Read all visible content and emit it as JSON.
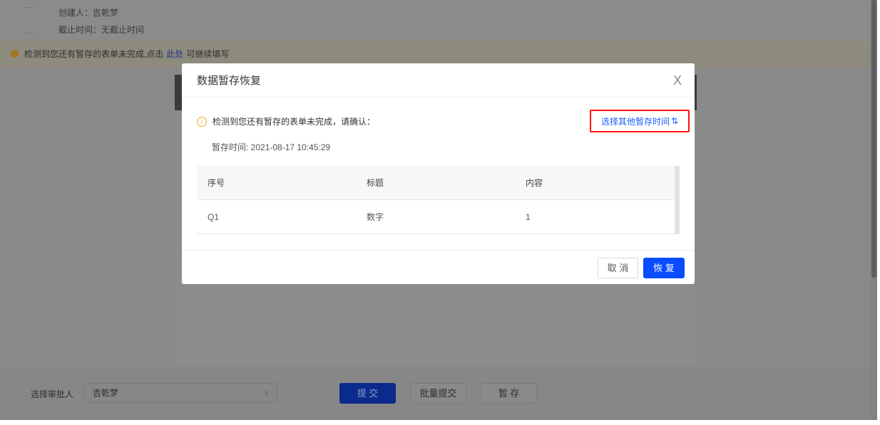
{
  "header": {
    "creator_label": "创建人：吉乾梦",
    "deadline_label": "截止时间：无截止时间"
  },
  "warning_bar": {
    "text_before": "检测到您还有暂存的表单未完成,点击",
    "link": "此处",
    "text_after": "可继续填写"
  },
  "footer": {
    "approver_label": "选择审批人",
    "approver_value": "吉乾梦",
    "submit": "提 交",
    "batch_submit": "批量提交",
    "save_draft": "暂 存"
  },
  "modal": {
    "title": "数据暂存恢复",
    "close": "X",
    "message": "检测到您还有暂存的表单未完成，请确认：",
    "other_time_link": "选择其他暂存时间",
    "saved_time": "暂存时间: 2021-08-17 10:45:29",
    "table": {
      "headers": [
        "序号",
        "标题",
        "内容"
      ],
      "rows": [
        [
          "Q1",
          "数字",
          "1"
        ]
      ]
    },
    "cancel": "取 消",
    "restore": "恢 复"
  }
}
